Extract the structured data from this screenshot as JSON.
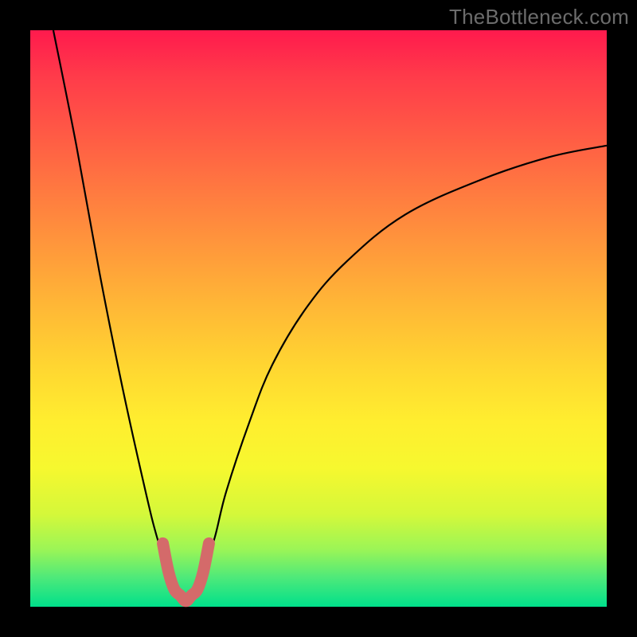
{
  "watermark": "TheBottleneck.com",
  "chart_data": {
    "type": "line",
    "title": "",
    "xlabel": "",
    "ylabel": "",
    "xlim": [
      0,
      100
    ],
    "ylim": [
      0,
      100
    ],
    "grid": false,
    "legend": false,
    "background_gradient": {
      "direction": "vertical",
      "stops": [
        {
          "pos": 0,
          "color": "#ff1a4d"
        },
        {
          "pos": 50,
          "color": "#ffd531"
        },
        {
          "pos": 100,
          "color": "#00e08b"
        }
      ]
    },
    "series": [
      {
        "name": "bottleneck-curve",
        "type": "line",
        "color": "#000000",
        "x": [
          4,
          8,
          12,
          16,
          20,
          22,
          24,
          26,
          27,
          28,
          30,
          32,
          34,
          38,
          42,
          48,
          55,
          65,
          78,
          90,
          100
        ],
        "y": [
          100,
          80,
          58,
          38,
          20,
          12,
          6,
          2,
          1,
          2,
          6,
          12,
          20,
          32,
          42,
          52,
          60,
          68,
          74,
          78,
          80
        ]
      },
      {
        "name": "highlight-segment",
        "type": "line",
        "color": "#d46a6a",
        "linewidth": 6,
        "x": [
          23,
          24,
          25,
          26,
          27,
          28,
          29,
          30,
          31
        ],
        "y": [
          11,
          6,
          3,
          2,
          1,
          2,
          3,
          6,
          11
        ]
      }
    ],
    "annotations": []
  }
}
